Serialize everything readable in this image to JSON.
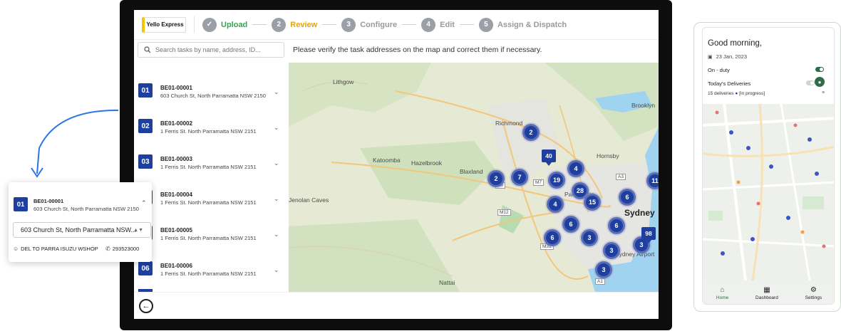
{
  "header": {
    "logo_text": "Yello Express",
    "steps": [
      {
        "num": "✓",
        "label": "Upload",
        "state": "done"
      },
      {
        "num": "2",
        "label": "Review",
        "state": "active"
      },
      {
        "num": "3",
        "label": "Configure",
        "state": "pending"
      },
      {
        "num": "4",
        "label": "Edit",
        "state": "pending"
      },
      {
        "num": "5",
        "label": "Assign & Dispatch",
        "state": "pending"
      }
    ]
  },
  "search": {
    "placeholder": "Search tasks by name, address, ID..."
  },
  "notice": "Please verify the task addresses on the map and correct them if necessary.",
  "tasks": [
    {
      "index": "01",
      "id": "BE01-00001",
      "address": "603 Church St, North Parramatta NSW 2150"
    },
    {
      "index": "02",
      "id": "BE01-00002",
      "address": "1 Ferris St. North Parramatta NSW 2151"
    },
    {
      "index": "03",
      "id": "BE01-00003",
      "address": "1 Ferris St. North Parramatta NSW 2151"
    },
    {
      "index": "04",
      "id": "BE01-00004",
      "address": "1 Ferris St. North Parramatta NSW 2151"
    },
    {
      "index": "05",
      "id": "BE01-00005",
      "address": "1 Ferris St. North Parramatta NSW 2151"
    },
    {
      "index": "06",
      "id": "BE01-00006",
      "address": "1 Ferris St. North Parramatta NSW 2151"
    }
  ],
  "map": {
    "places": [
      "Lithgow",
      "Richmond",
      "Katoomba",
      "Hazelbrook",
      "Blaxland",
      "Hornsby",
      "Brooklyn",
      "Jenolan Caves",
      "Parramatta",
      "Sydney",
      "Nattai",
      "Sydney Airport"
    ],
    "road_tags": [
      "A9",
      "M7",
      "A3",
      "M12",
      "M31",
      "A1"
    ],
    "clusters": [
      "2",
      "2",
      "7",
      "19",
      "4",
      "28",
      "15",
      "6",
      "4",
      "6",
      "6",
      "6",
      "3",
      "3",
      "3",
      "3",
      "11"
    ],
    "pins": [
      "40",
      "98"
    ]
  },
  "popup": {
    "index": "01",
    "id": "BE01-00001",
    "address": "603 Church St, North Parramatta NSW 2150",
    "selected_address": "603 Church St, North Parramatta NSW...",
    "contact_name": "DEL TO PARRA ISUZU WSHOP",
    "phone": "293523000"
  },
  "phone": {
    "greeting": "Good morning,",
    "date": "23 Jan, 2023",
    "duty_label": "On - duty",
    "deliveries_label": "Today's Deliveries",
    "deliveries_status": "15 deliveries",
    "deliveries_progress": "[In progress]",
    "nav": [
      {
        "label": "Home",
        "icon": "home-icon"
      },
      {
        "label": "Dashboard",
        "icon": "dashboard-icon"
      },
      {
        "label": "Settings",
        "icon": "settings-icon"
      }
    ]
  },
  "colors": {
    "brand_blue": "#1f3f9f",
    "done_green": "#2fa84f",
    "active_amber": "#e8a400",
    "phone_green": "#2e6b48"
  }
}
